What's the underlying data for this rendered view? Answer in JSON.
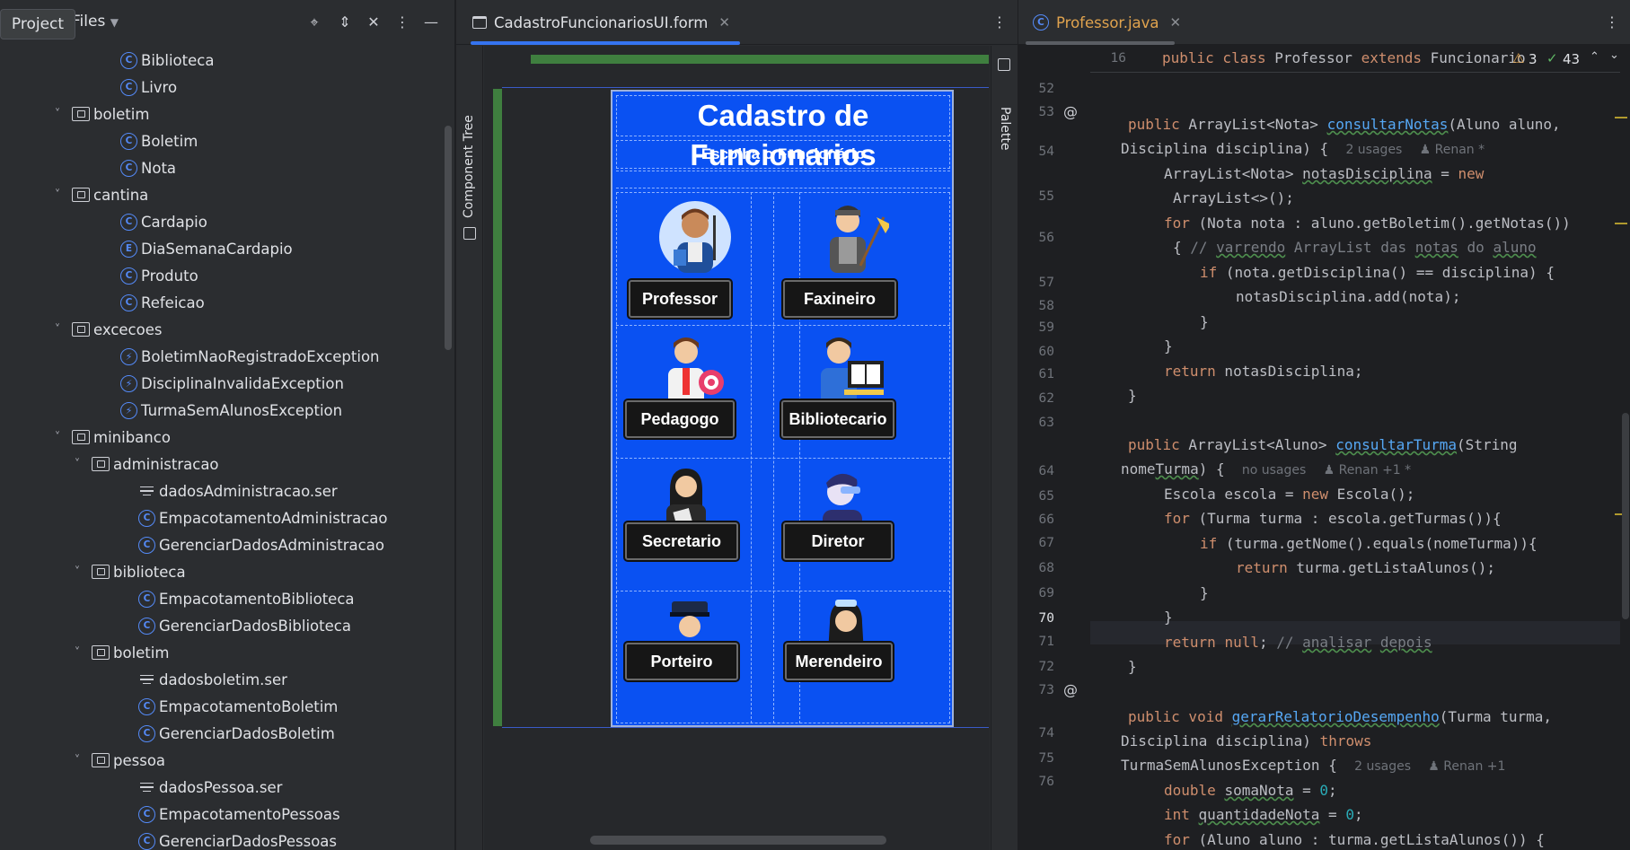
{
  "project_panel": {
    "title_chip": "Project",
    "view_label": "Files",
    "tree": [
      {
        "label": "Biblioteca",
        "icon": "class-icon",
        "depth": 2
      },
      {
        "label": "Livro",
        "icon": "class-icon",
        "depth": 2
      },
      {
        "label": "boletim",
        "icon": "folder-icon",
        "depth": 1,
        "expanded": true
      },
      {
        "label": "Boletim",
        "icon": "class-icon",
        "depth": 2
      },
      {
        "label": "Nota",
        "icon": "class-icon",
        "depth": 2
      },
      {
        "label": "cantina",
        "icon": "folder-icon",
        "depth": 1,
        "expanded": true
      },
      {
        "label": "Cardapio",
        "icon": "class-icon",
        "depth": 2
      },
      {
        "label": "DiaSemanaCardapio",
        "icon": "enum-icon",
        "depth": 2
      },
      {
        "label": "Produto",
        "icon": "class-icon",
        "depth": 2
      },
      {
        "label": "Refeicao",
        "icon": "class-icon",
        "depth": 2
      },
      {
        "label": "excecoes",
        "icon": "folder-icon",
        "depth": 1,
        "expanded": true
      },
      {
        "label": "BoletimNaoRegistradoException",
        "icon": "exception-icon",
        "depth": 2
      },
      {
        "label": "DisciplinaInvalidaException",
        "icon": "exception-icon",
        "depth": 2
      },
      {
        "label": "TurmaSemAlunosException",
        "icon": "exception-icon",
        "depth": 2
      },
      {
        "label": "minibanco",
        "icon": "folder-icon",
        "depth": 1,
        "expanded": true
      },
      {
        "label": "administracao",
        "icon": "folder-icon",
        "depth": 2,
        "expanded": true
      },
      {
        "label": "dadosAdministracao.ser",
        "icon": "text-file-icon",
        "depth": 3
      },
      {
        "label": "EmpacotamentoAdministracao",
        "icon": "class-icon",
        "depth": 3
      },
      {
        "label": "GerenciarDadosAdministracao",
        "icon": "class-icon",
        "depth": 3
      },
      {
        "label": "biblioteca",
        "icon": "folder-icon",
        "depth": 2,
        "expanded": true
      },
      {
        "label": "EmpacotamentoBiblioteca",
        "icon": "class-icon",
        "depth": 3
      },
      {
        "label": "GerenciarDadosBiblioteca",
        "icon": "class-icon",
        "depth": 3
      },
      {
        "label": "boletim",
        "icon": "folder-icon",
        "depth": 2,
        "expanded": true
      },
      {
        "label": "dadosboletim.ser",
        "icon": "text-file-icon",
        "depth": 3
      },
      {
        "label": "EmpacotamentoBoletim",
        "icon": "class-icon",
        "depth": 3
      },
      {
        "label": "GerenciarDadosBoletim",
        "icon": "class-icon",
        "depth": 3
      },
      {
        "label": "pessoa",
        "icon": "folder-icon",
        "depth": 2,
        "expanded": true
      },
      {
        "label": "dadosPessoa.ser",
        "icon": "text-file-icon",
        "depth": 3
      },
      {
        "label": "EmpacotamentoPessoas",
        "icon": "class-icon",
        "depth": 3
      },
      {
        "label": "GerenciarDadosPessoas",
        "icon": "class-icon",
        "depth": 3
      }
    ]
  },
  "designer": {
    "tab_label": "CadastroFuncionariosUI.form",
    "component_tree_label": "Component Tree",
    "palette_label": "Palette",
    "form_title": "Cadastro de Funcionarios",
    "form_subtitle": "Escolha o Funcionário",
    "buttons": [
      "Professor",
      "Faxineiro",
      "Pedagogo",
      "Bibliotecario",
      "Secretario",
      "Diretor",
      "Porteiro",
      "Merendeiro"
    ]
  },
  "editor": {
    "tab_label": "Professor.java",
    "sticky_line_number": "16",
    "sticky_code": "public class Professor extends Funcionario",
    "warnings_count": "3",
    "checks_count": "43",
    "current_line": "70",
    "hints": {
      "h53": "2 usages",
      "h53_author": "Renan *",
      "h63": "no usages",
      "h63_author": "Renan +1 *",
      "h73": "2 usages",
      "h73_author": "Renan +1"
    },
    "line_numbers": [
      "52",
      "53",
      "54",
      "55",
      "56",
      "57",
      "58",
      "59",
      "60",
      "61",
      "62",
      "63",
      "64",
      "65",
      "66",
      "67",
      "68",
      "69",
      "70",
      "71",
      "72",
      "73",
      "74",
      "75",
      "76"
    ]
  },
  "colors": {
    "accent": "#3574f0",
    "form_background": "#0a51f2",
    "keyword": "#cf8e6d",
    "method": "#56a8f5"
  }
}
